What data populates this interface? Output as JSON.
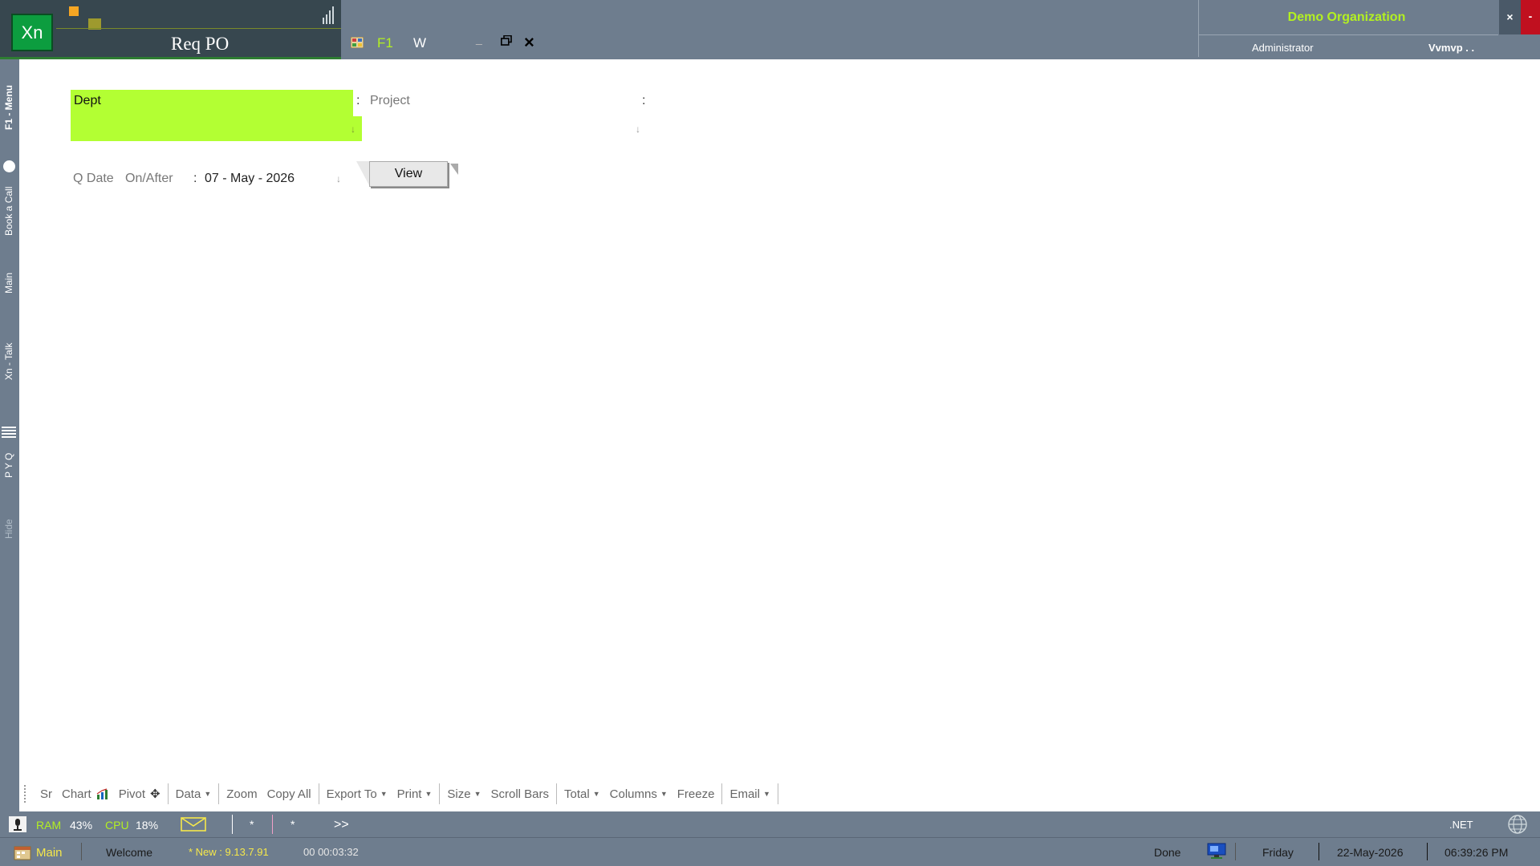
{
  "app": {
    "logo_text": "Xn",
    "title": "Req PO",
    "tab_f1": "F1",
    "tab_w": "W"
  },
  "org": {
    "name": "Demo Organization",
    "role": "Administrator",
    "user": "Vvmvp . .",
    "close": "×",
    "minimize": "-"
  },
  "left_bar": [
    "F1 - Menu",
    "Book a Call",
    "Main",
    "Xn - Talk",
    "P Y Q",
    "Hide"
  ],
  "form": {
    "dept_label": "Dept",
    "dept_value": "",
    "project_label": "Project",
    "qdate_label": "Q Date",
    "onafter_label": "On/After",
    "qdate_value": "07 - May - 2026",
    "view_button": "View"
  },
  "toolbar": {
    "sr": "Sr",
    "chart": "Chart",
    "pivot": "Pivot",
    "data": "Data",
    "zoom": "Zoom",
    "copy_all": "Copy All",
    "export_to": "Export To",
    "print": "Print",
    "size": "Size",
    "scroll_bars": "Scroll Bars",
    "total": "Total",
    "columns": "Columns",
    "freeze": "Freeze",
    "email": "Email"
  },
  "status": {
    "ram_label": "RAM",
    "ram_value": "43%",
    "cpu_label": "CPU",
    "cpu_value": "18%",
    "star1": "*",
    "star2": "*",
    "more": ">>",
    "net": ".NET",
    "main": "Main",
    "welcome": "Welcome",
    "new_version": "* New : 9.13.7.91",
    "timer": "00 00:03:32",
    "done": "Done",
    "day": "Friday",
    "date": "22-May-2026",
    "time": "06:39:26 PM"
  },
  "colors": {
    "accent_green": "#b3ff33",
    "frame": "#6e7d8e",
    "title_bg": "#37474f",
    "brand_green": "#0c9d3f"
  }
}
